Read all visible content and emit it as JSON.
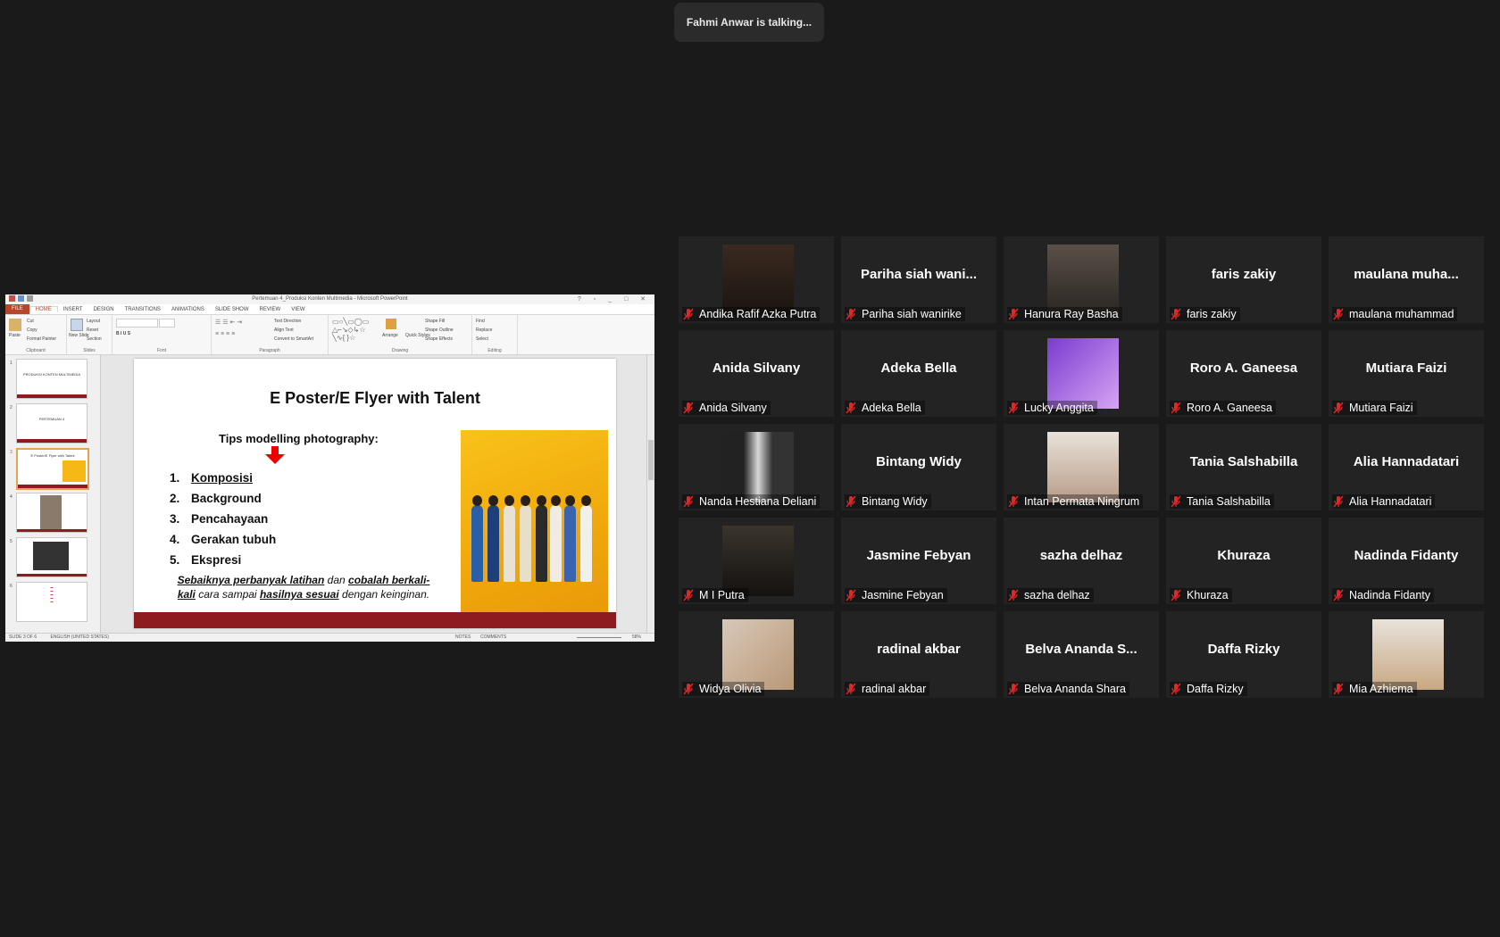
{
  "talking_banner": "Fahmi Anwar is talking...",
  "powerpoint": {
    "window_title": "Pertemuan 4_Produksi Konten Multimedia - Microsoft PowerPoint",
    "tabs": [
      "FILE",
      "HOME",
      "INSERT",
      "DESIGN",
      "TRANSITIONS",
      "ANIMATIONS",
      "SLIDE SHOW",
      "REVIEW",
      "VIEW"
    ],
    "ribbon": {
      "clipboard": {
        "paste": "Paste",
        "cut": "Cut",
        "copy": "Copy",
        "format_painter": "Format Painter",
        "label": "Clipboard"
      },
      "slides": {
        "new_slide": "New Slide",
        "layout": "Layout",
        "reset": "Reset",
        "section": "Section",
        "label": "Slides"
      },
      "font_label": "Font",
      "paragraph": {
        "text_direction": "Text Direction",
        "align_text": "Align Text",
        "convert": "Convert to SmartArt",
        "label": "Paragraph"
      },
      "drawing": {
        "arrange": "Arrange",
        "quick_styles": "Quick Styles",
        "shape_fill": "Shape Fill",
        "shape_outline": "Shape Outline",
        "shape_effects": "Shape Effects",
        "label": "Drawing"
      },
      "editing": {
        "find": "Find",
        "replace": "Replace",
        "select": "Select",
        "label": "Editing"
      }
    },
    "thumbnails": [
      {
        "num": "1",
        "text": "PRODUKSI KONTEN MULTIMEDIA"
      },
      {
        "num": "2",
        "text": "PERTEMUAN 4"
      },
      {
        "num": "3",
        "text": "E Poster/E Flyer with Talent"
      },
      {
        "num": "4",
        "text": ""
      },
      {
        "num": "5",
        "text": ""
      },
      {
        "num": "6",
        "text": ""
      }
    ],
    "slide": {
      "title": "E Poster/E Flyer with Talent",
      "subtitle": "Tips modelling photography:",
      "items": [
        {
          "num": "1.",
          "text": "Komposisi"
        },
        {
          "num": "2.",
          "text": "Background"
        },
        {
          "num": "3.",
          "text": "Pencahayaan"
        },
        {
          "num": "4.",
          "text": "Gerakan tubuh"
        },
        {
          "num": "5.",
          "text": "Ekspresi"
        }
      ],
      "note_parts": [
        "Sebaiknya perbanyak latihan",
        "dan",
        "cobalah berkali-kali",
        "cara sampai",
        "hasilnya sesuai",
        "dengan keinginan."
      ]
    },
    "status": {
      "slide_info": "SLIDE 3 OF 6",
      "language": "ENGLISH (UNITED STATES)",
      "notes": "NOTES",
      "comments": "COMMENTS",
      "zoom": "58%"
    }
  },
  "participants": [
    {
      "name": "Andika Rafif Azka Putra",
      "display": "",
      "has_video": true
    },
    {
      "name": "Pariha siah wanirike",
      "display": "Pariha siah wani...",
      "has_video": false
    },
    {
      "name": "Hanura Ray Basha",
      "display": "",
      "has_video": true
    },
    {
      "name": "faris zakiy",
      "display": "faris zakiy",
      "has_video": false
    },
    {
      "name": "maulana muhammad",
      "display": "maulana muha...",
      "has_video": false
    },
    {
      "name": "Anida Silvany",
      "display": "Anida Silvany",
      "has_video": false
    },
    {
      "name": "Adeka Bella",
      "display": "Adeka Bella",
      "has_video": false
    },
    {
      "name": "Lucky Anggita",
      "display": "",
      "has_video": true
    },
    {
      "name": "Roro A. Ganeesa",
      "display": "Roro A. Ganeesa",
      "has_video": false
    },
    {
      "name": "Mutiara Faizi",
      "display": "Mutiara Faizi",
      "has_video": false
    },
    {
      "name": "Nanda Hestiana Deliani",
      "display": "",
      "has_video": true
    },
    {
      "name": "Bintang Widy",
      "display": "Bintang Widy",
      "has_video": false
    },
    {
      "name": "Intan Permata Ningrum",
      "display": "",
      "has_video": true
    },
    {
      "name": "Tania Salshabilla",
      "display": "Tania Salshabilla",
      "has_video": false
    },
    {
      "name": "Alia Hannadatari",
      "display": "Alia Hannadatari",
      "has_video": false
    },
    {
      "name": "M I Putra",
      "display": "",
      "has_video": true
    },
    {
      "name": "Jasmine Febyan",
      "display": "Jasmine Febyan",
      "has_video": false
    },
    {
      "name": "sazha delhaz",
      "display": "sazha delhaz",
      "has_video": false
    },
    {
      "name": "Khuraza",
      "display": "Khuraza",
      "has_video": false
    },
    {
      "name": "Nadinda Fidanty",
      "display": "Nadinda Fidanty",
      "has_video": false
    },
    {
      "name": "Widya Olivia",
      "display": "",
      "has_video": true
    },
    {
      "name": "radinal akbar",
      "display": "radinal akbar",
      "has_video": false
    },
    {
      "name": "Belva Ananda Shara",
      "display": "Belva Ananda S...",
      "has_video": false
    },
    {
      "name": "Daffa Rizky",
      "display": "Daffa Rizky",
      "has_video": false
    },
    {
      "name": "Mia Azhiema",
      "display": "",
      "has_video": true
    }
  ],
  "colors": {
    "background": "#1a1a1a",
    "tile": "#232323",
    "muted_mic": "#e02828",
    "accent_ppt": "#b7472a"
  }
}
